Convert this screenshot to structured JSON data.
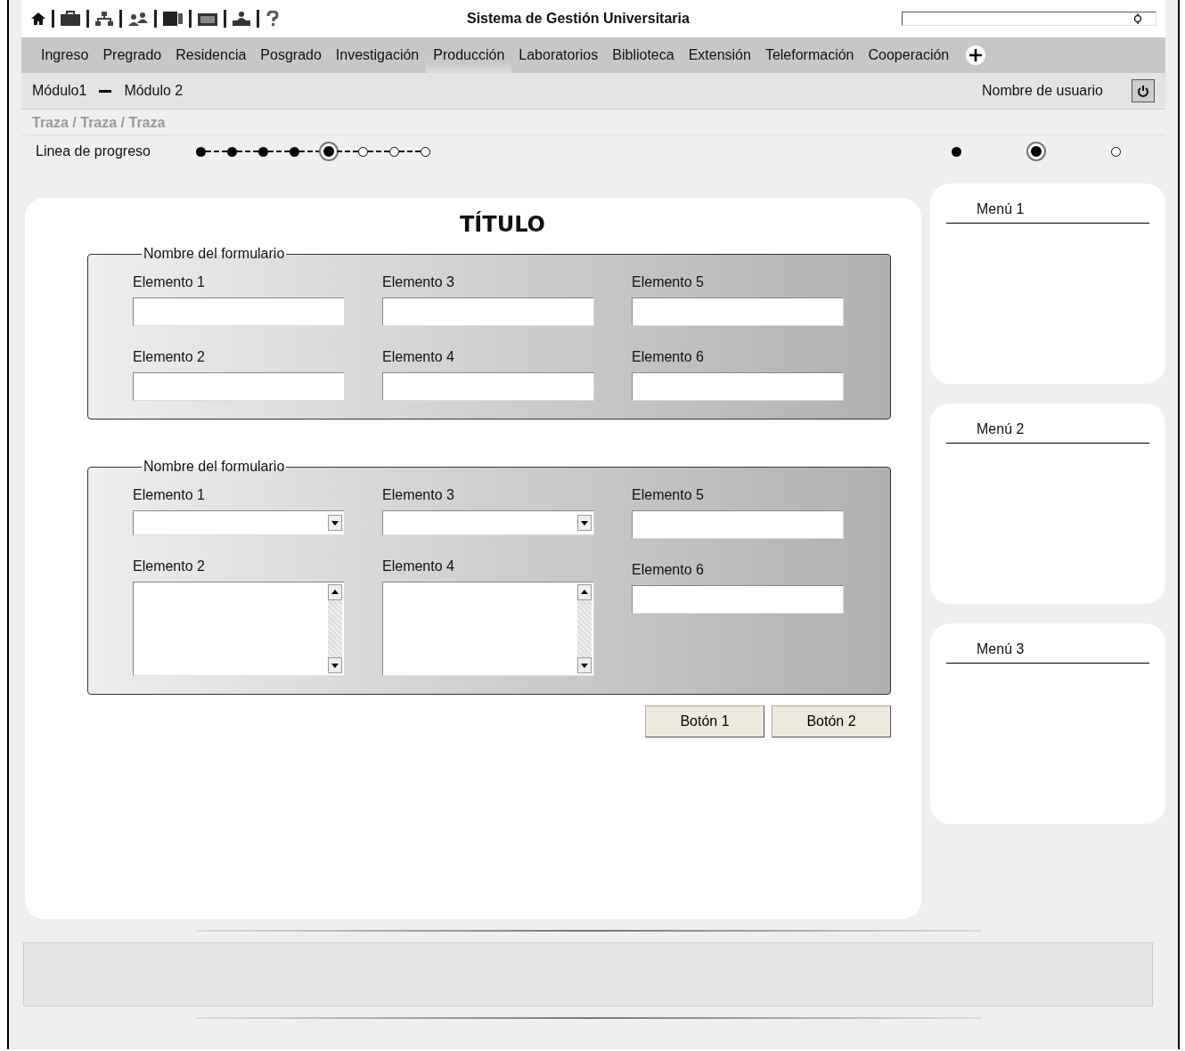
{
  "header": {
    "title": "Sistema de Gestión Universitaria"
  },
  "nav": [
    {
      "label": "Ingreso",
      "selected": false
    },
    {
      "label": "Pregrado",
      "selected": false
    },
    {
      "label": "Residencia",
      "selected": false
    },
    {
      "label": "Posgrado",
      "selected": false
    },
    {
      "label": "Investigación",
      "selected": false
    },
    {
      "label": "Producción",
      "selected": true
    },
    {
      "label": "Laboratorios",
      "selected": false
    },
    {
      "label": "Biblioteca",
      "selected": false
    },
    {
      "label": "Extensión",
      "selected": false
    },
    {
      "label": "Teleformación",
      "selected": false
    },
    {
      "label": "Cooperación",
      "selected": false
    }
  ],
  "modules": {
    "first": "Módulo1",
    "second": "Módulo 2"
  },
  "user": "Nombre de usuario",
  "breadcrumb": "Traza / Traza / Traza",
  "progress": {
    "label": "Linea de progreso",
    "steps": [
      {
        "kind": "done"
      },
      {
        "kind": "done"
      },
      {
        "kind": "done"
      },
      {
        "kind": "done"
      },
      {
        "kind": "current"
      },
      {
        "kind": "pending"
      },
      {
        "kind": "pending"
      },
      {
        "kind": "pending"
      }
    ],
    "legend": [
      {
        "kind": "done"
      },
      {
        "kind": "current"
      },
      {
        "kind": "pending"
      }
    ]
  },
  "title": "TÍTULO",
  "forms": [
    {
      "name": "Nombre del formulario",
      "columns": [
        [
          {
            "label": "Elemento 1",
            "kind": "text"
          },
          {
            "label": "Elemento 2",
            "kind": "text"
          }
        ],
        [
          {
            "label": "Elemento 3",
            "kind": "text"
          },
          {
            "label": "Elemento 4",
            "kind": "text"
          }
        ],
        [
          {
            "label": "Elemento 5",
            "kind": "text"
          },
          {
            "label": "Elemento 6",
            "kind": "text"
          }
        ]
      ]
    },
    {
      "name": "Nombre del formulario",
      "columns": [
        [
          {
            "label": "Elemento 1",
            "kind": "select"
          },
          {
            "label": "Elemento 2",
            "kind": "textarea"
          }
        ],
        [
          {
            "label": "Elemento 3",
            "kind": "select"
          },
          {
            "label": "Elemento 4",
            "kind": "textarea"
          }
        ],
        [
          {
            "label": "Elemento 5",
            "kind": "text"
          },
          {
            "label": "Elemento 6",
            "kind": "text"
          }
        ]
      ]
    }
  ],
  "buttons": [
    "Botón 1",
    "Botón 2"
  ],
  "menus": [
    "Menú 1",
    "Menú 2",
    "Menú 3"
  ]
}
